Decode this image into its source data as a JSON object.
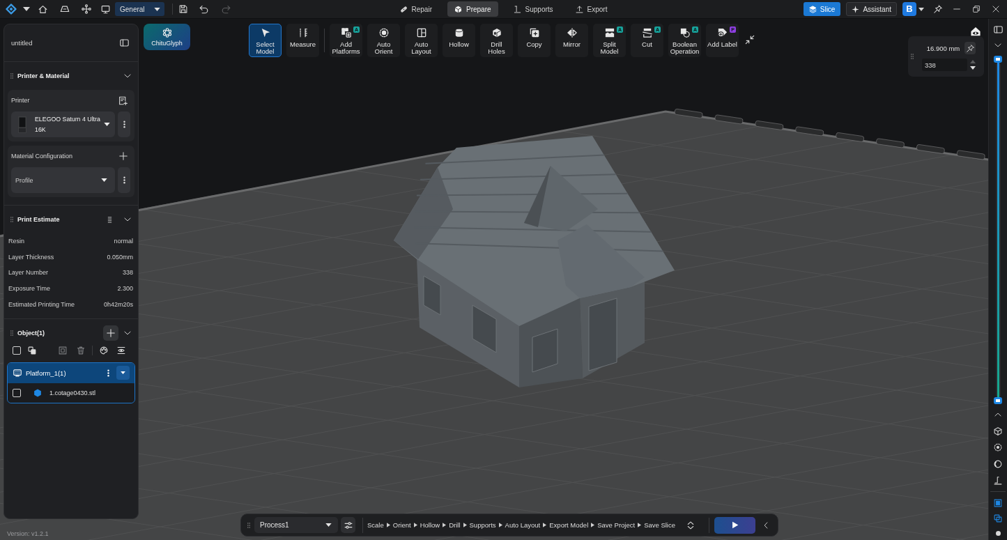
{
  "top_bar": {
    "workspace": {
      "value": "General"
    },
    "undo_disabled": false,
    "redo_disabled": true,
    "modes": [
      {
        "label": "Repair",
        "selected": false
      },
      {
        "label": "Prepare",
        "selected": true
      },
      {
        "label": "Supports",
        "selected": false
      },
      {
        "label": "Export",
        "selected": false
      }
    ],
    "slice_button": "Slice",
    "assistant_button": "Assistant",
    "account_initial": "B"
  },
  "side_panel": {
    "project_title": "untitled",
    "printer_material": {
      "title": "Printer & Material",
      "expanded": true,
      "printer_label": "Printer",
      "printer": {
        "value": "ELEGOO Saturn 4 Ultra 16K"
      },
      "material_label": "Material Configuration",
      "material": {
        "value": "Profile"
      }
    },
    "print_estimate": {
      "title": "Print Estimate",
      "expanded": true,
      "rows": [
        {
          "label": "Resin",
          "value": "normal"
        },
        {
          "label": "Layer Thickness",
          "value": "0.050mm"
        },
        {
          "label": "Layer Number",
          "value": "338"
        },
        {
          "label": "Exposure Time",
          "value": "2.300"
        },
        {
          "label": "Estimated Printing Time",
          "value": "0h42m20s"
        }
      ]
    },
    "objects": {
      "title": "Object(1)",
      "expanded": true,
      "select_all_checked": false,
      "platforms": [
        {
          "name": "Platform_1(1)",
          "selected": true,
          "expanded": true,
          "children": [
            {
              "name": "1.cotage0430.stl",
              "checked": false
            }
          ]
        }
      ]
    }
  },
  "version": "Version: v1.2.1",
  "brand_button": "ChituGlyph",
  "toolbar": {
    "groups": [
      [
        {
          "label": "Select Model",
          "selected": true
        },
        {
          "label": "Measure",
          "selected": false
        }
      ],
      [
        {
          "label": "Add Platforms",
          "selected": false,
          "badge": {
            "text": "A",
            "color": "#17a39c"
          }
        },
        {
          "label": "Auto Orient",
          "selected": false
        },
        {
          "label": "Auto Layout",
          "selected": false
        },
        {
          "label": "Hollow",
          "selected": false
        },
        {
          "label": "Drill Holes",
          "selected": false
        },
        {
          "label": "Copy",
          "selected": false
        },
        {
          "label": "Mirror",
          "selected": false
        },
        {
          "label": "Split Model",
          "selected": false,
          "badge": {
            "text": "A",
            "color": "#17a39c"
          }
        },
        {
          "label": "Cut",
          "selected": false,
          "badge": {
            "text": "A",
            "color": "#17a39c"
          }
        },
        {
          "label": "Boolean Operation",
          "selected": false,
          "badge": {
            "text": "A",
            "color": "#17a39c"
          }
        },
        {
          "label": "Add Label",
          "selected": false,
          "badge": {
            "text": "P",
            "color": "#8e3fe0"
          }
        }
      ]
    ]
  },
  "layer_panel": {
    "height": "16.900 mm",
    "layer": {
      "value": "338"
    }
  },
  "layer_slider": {
    "level": 1
  },
  "view_toggles": [
    {
      "on": true
    },
    {
      "on": true
    }
  ],
  "process_bar": {
    "process": {
      "value": "Process1"
    },
    "steps": [
      "Scale",
      "Orient",
      "Hollow",
      "Drill",
      "Supports",
      "Auto Layout",
      "Export Model",
      "Save Project",
      "Save Slice"
    ]
  }
}
